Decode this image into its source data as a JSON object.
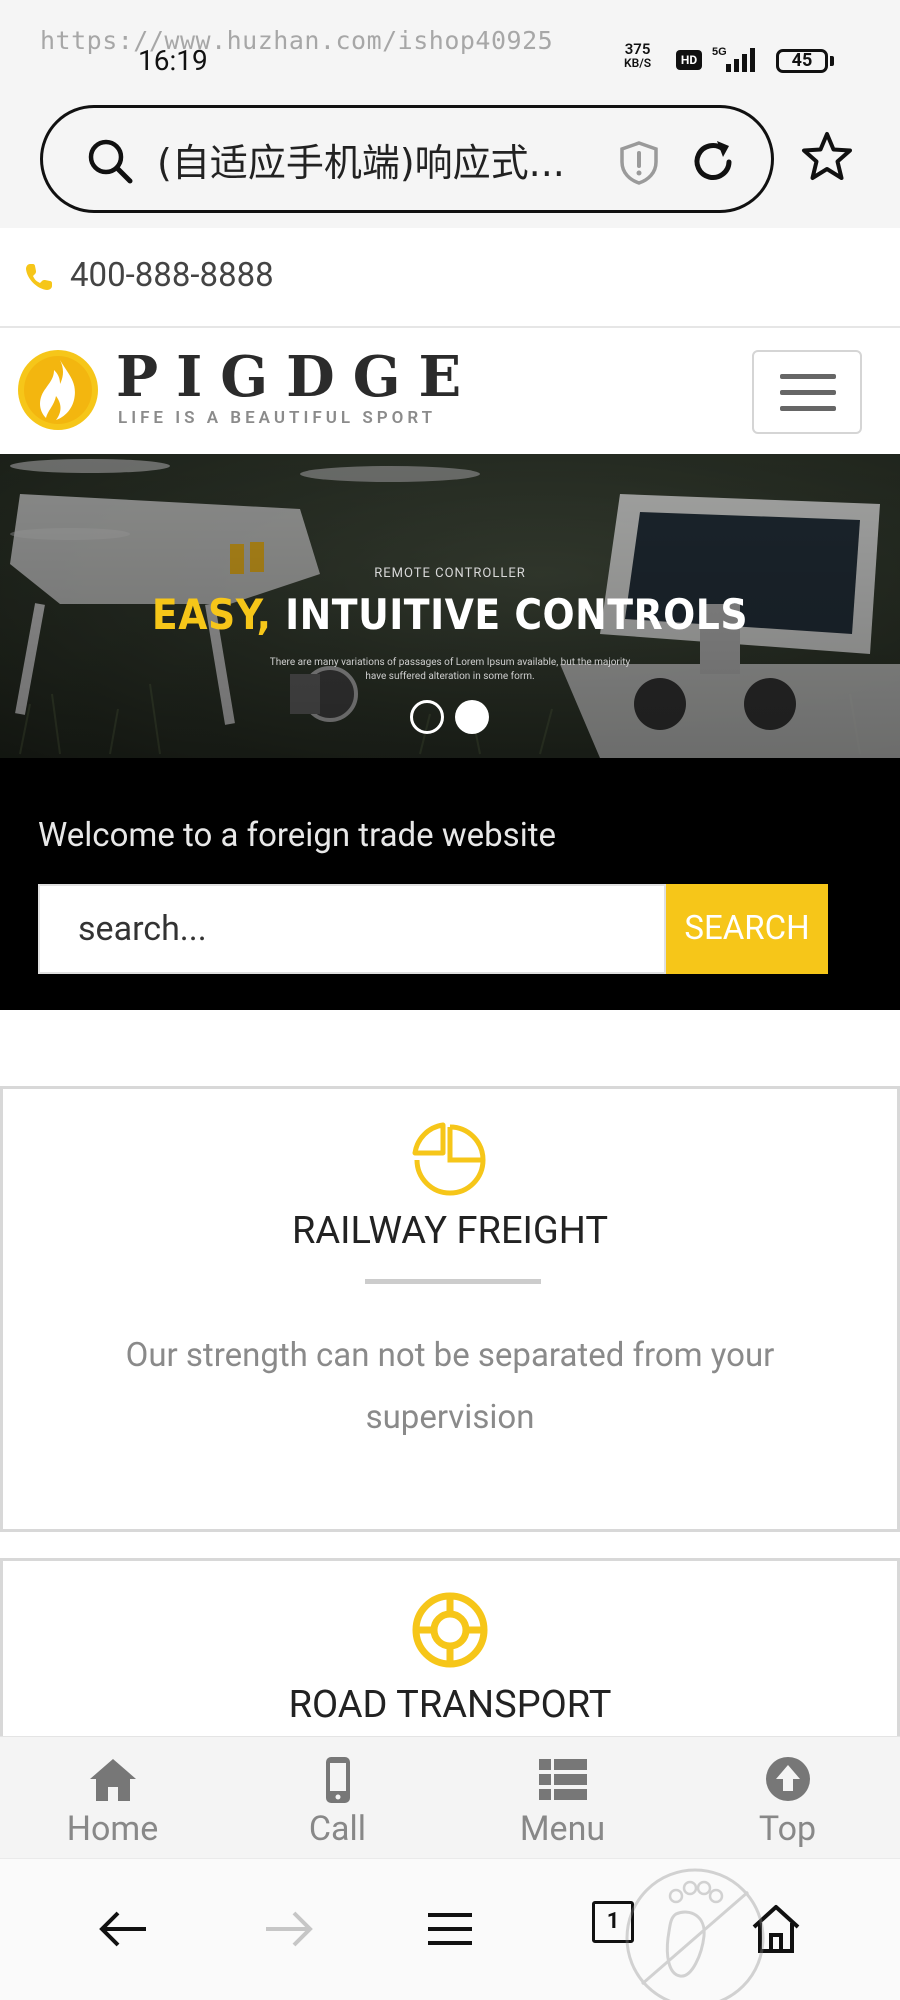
{
  "status_bar": {
    "watermark": "https://www.huzhan.com/ishop40925",
    "time": "16:19",
    "net_speed_value": "375",
    "net_speed_unit": "KB/S",
    "hd_label": "HD",
    "network_type": "5G",
    "battery": "45"
  },
  "browser": {
    "url_text": "(自适应手机端)响应式...",
    "tab_count": "1"
  },
  "topbar": {
    "phone": "400-888-8888"
  },
  "header": {
    "logo_word": "PIGDGE",
    "logo_tagline": "LIFE IS A BEAUTIFUL SPORT"
  },
  "hero": {
    "kicker": "REMOTE CONTROLLER",
    "title_accent": "EASY,",
    "title_rest": " INTUITIVE CONTROLS",
    "description_line1": "There are many variations of passages of Lorem Ipsum available, but the majority",
    "description_line2": "have suffered alteration in some form."
  },
  "welcome": {
    "text": "Welcome to a foreign trade website",
    "search_value": "search...",
    "search_button": "SEARCH"
  },
  "services": [
    {
      "title": "RAILWAY FREIGHT",
      "text": "Our strength can not be separated from your supervision"
    },
    {
      "title": "ROAD TRANSPORT"
    }
  ],
  "bottom_nav": [
    {
      "label": "Home",
      "icon": "home-icon"
    },
    {
      "label": "Call",
      "icon": "mobile-phone-icon"
    },
    {
      "label": "Menu",
      "icon": "list-icon"
    },
    {
      "label": "Top",
      "icon": "arrow-up-circle-icon"
    }
  ],
  "colors": {
    "accent": "#f6c619",
    "dark": "#000000",
    "nav_gray": "#888888"
  }
}
